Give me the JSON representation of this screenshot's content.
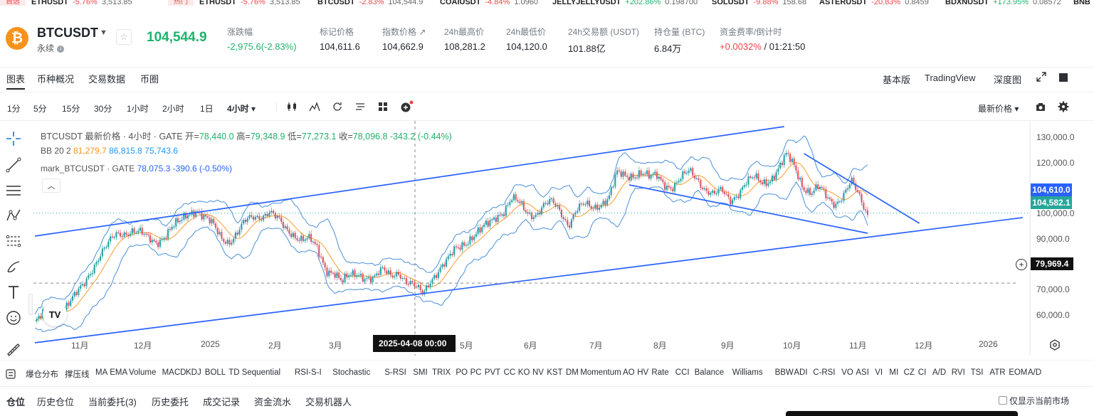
{
  "ticker": [
    {
      "sym": "ETHUSDT",
      "pct": "-5.76%",
      "px": "3,513.85",
      "dir": "down",
      "tag": "自选"
    },
    {
      "sym": "ETHUSDT",
      "pct": "-5.76%",
      "px": "3,513.85",
      "dir": "down",
      "tag": "热门"
    },
    {
      "sym": "BTCUSDT",
      "pct": "-2.83%",
      "px": "104,544.9",
      "dir": "down"
    },
    {
      "sym": "COAIUSDT",
      "pct": "-4.84%",
      "px": "1.0960",
      "dir": "down"
    },
    {
      "sym": "JELLYJELLYUSDT",
      "pct": "+202.86%",
      "px": "0.198700",
      "dir": "up"
    },
    {
      "sym": "SOLUSDT",
      "pct": "-9.88%",
      "px": "158.68",
      "dir": "down"
    },
    {
      "sym": "ASTERUSDT",
      "pct": "-20.83%",
      "px": "0.8459",
      "dir": "down"
    },
    {
      "sym": "BDXNUSDT",
      "pct": "+173.95%",
      "px": "0.08572",
      "dir": "up"
    },
    {
      "sym": "BNB",
      "pct": "",
      "px": "",
      "dir": "down"
    }
  ],
  "header": {
    "coin_glyph": "₿",
    "symbol": "BTCUSDT",
    "contract": "永续",
    "last_price": "104,544.9",
    "stats": [
      {
        "label": "涨跌幅",
        "value": "-2,975.6(-2.83%)",
        "color": "#20b26c"
      },
      {
        "label": "标记价格",
        "value": "104,611.6"
      },
      {
        "label": "指数价格 ↗",
        "value": "104,662.9"
      },
      {
        "label": "24h最高价",
        "value": "108,281.2"
      },
      {
        "label": "24h最低价",
        "value": "104,120.0"
      },
      {
        "label": "24h交易额 (USDT)",
        "value": "101.88亿"
      },
      {
        "label": "持仓量 (BTC)",
        "value": "6.84万"
      },
      {
        "label": "资金费率/倒计时",
        "value_a": "+0.0032%",
        "value_b": " / 01:21:50"
      }
    ]
  },
  "tabs": [
    "图表",
    "币种概况",
    "交易数据",
    "币圈"
  ],
  "view_options": [
    "基本版",
    "TradingView",
    "深度图"
  ],
  "toolbar": {
    "intervals": [
      "1分",
      "5分",
      "15分",
      "30分",
      "1小时",
      "2小时",
      "1日",
      "4小时 ▾"
    ],
    "price_type": "最新价格 ▾"
  },
  "legend": {
    "line1_prefix": "BTCUSDT 最新价格 · 4小时 · GATE",
    "open_label": "开=",
    "open": "78,440.0",
    "high_label": "高=",
    "high": "79,348.9",
    "low_label": "低=",
    "low": "77,273.1",
    "close_label": "收=",
    "close": "78,096.8",
    "change": "-343.2 (-0.44%)",
    "bb_label": "BB 20 2",
    "bb_mid": "81,279.7",
    "bb_upper": "86,815.8",
    "bb_lower": "75,743.6",
    "mark_label": "mark_BTCUSDT · GATE",
    "mark_value": "78,075.3",
    "mark_change": "-390.6 (-0.50%)"
  },
  "yaxis": [
    "130,000.0",
    "120,000.0",
    "100,000.0",
    "90,000.0",
    "70,000.0",
    "60,000.0"
  ],
  "price_tags": {
    "mark": "104,610.0",
    "last": "104,582.1",
    "cursor": "79,969.4"
  },
  "xaxis": [
    "11月",
    "12月",
    "2025",
    "2月",
    "3月",
    "5月",
    "6月",
    "7月",
    "8月",
    "9月",
    "10月",
    "11月",
    "12月",
    "2026"
  ],
  "crosshair_date": "2025-04-08  00:00",
  "indicators": [
    "爆仓分布",
    "撑压线",
    "MA",
    "EMA",
    "Volume",
    "MACD",
    "KDJ",
    "BOLL",
    "TD Sequential",
    "RSI-S-I",
    "Stochastic",
    "S-RSI",
    "SMI",
    "TRIX",
    "PO",
    "PC",
    "PVT",
    "CC",
    "KO",
    "NV",
    "KST",
    "DM",
    "Momentum",
    "AO",
    "HV",
    "Rate",
    "CCI",
    "Balance",
    "Williams",
    "BBW",
    "ADI",
    "C-RSI",
    "VO",
    "ASI",
    "VI",
    "MI",
    "CZ",
    "CI",
    "A/D",
    "RVI",
    "TSI",
    "ATR",
    "EOM",
    "A/D"
  ],
  "bottom_tabs": [
    "仓位",
    "历史仓位",
    "当前委托(3)",
    "历史委托",
    "成交记录",
    "资金流水",
    "交易机器人"
  ],
  "bottom_right": "仅显示当前市场",
  "chart_data": {
    "type": "candlestick",
    "series_closes": [
      66000,
      68500,
      70500,
      69800,
      72500,
      75000,
      79000,
      85000,
      90000,
      93000,
      96500,
      97800,
      99000,
      97500,
      95000,
      94500,
      97000,
      99500,
      101000,
      104500,
      106500,
      103000,
      100000,
      96000,
      95000,
      97500,
      101000,
      103000,
      104000,
      105500,
      102000,
      98500,
      97500,
      96000,
      95000,
      91000,
      85000,
      84500,
      80000,
      82000,
      83500,
      82500,
      81500,
      84000,
      83000,
      84500,
      80000,
      78000,
      76500,
      82000,
      84500,
      87000,
      92000,
      94500,
      96000,
      97500,
      100500,
      104000,
      105500,
      109000,
      107500,
      105000,
      104500,
      107000,
      108000,
      105500,
      101000,
      105500,
      107000,
      106500,
      108500,
      110000,
      118000,
      117500,
      118500,
      119000,
      116500,
      117500,
      115000,
      114000,
      116500,
      119000,
      117000,
      113000,
      110500,
      112000,
      109500,
      112000,
      115000,
      116500,
      115500,
      117000,
      120000,
      124500,
      121000,
      114500,
      111500,
      113000,
      110000,
      108500,
      111000,
      115000,
      110000,
      104500
    ],
    "ylim": [
      55000,
      135000
    ]
  }
}
